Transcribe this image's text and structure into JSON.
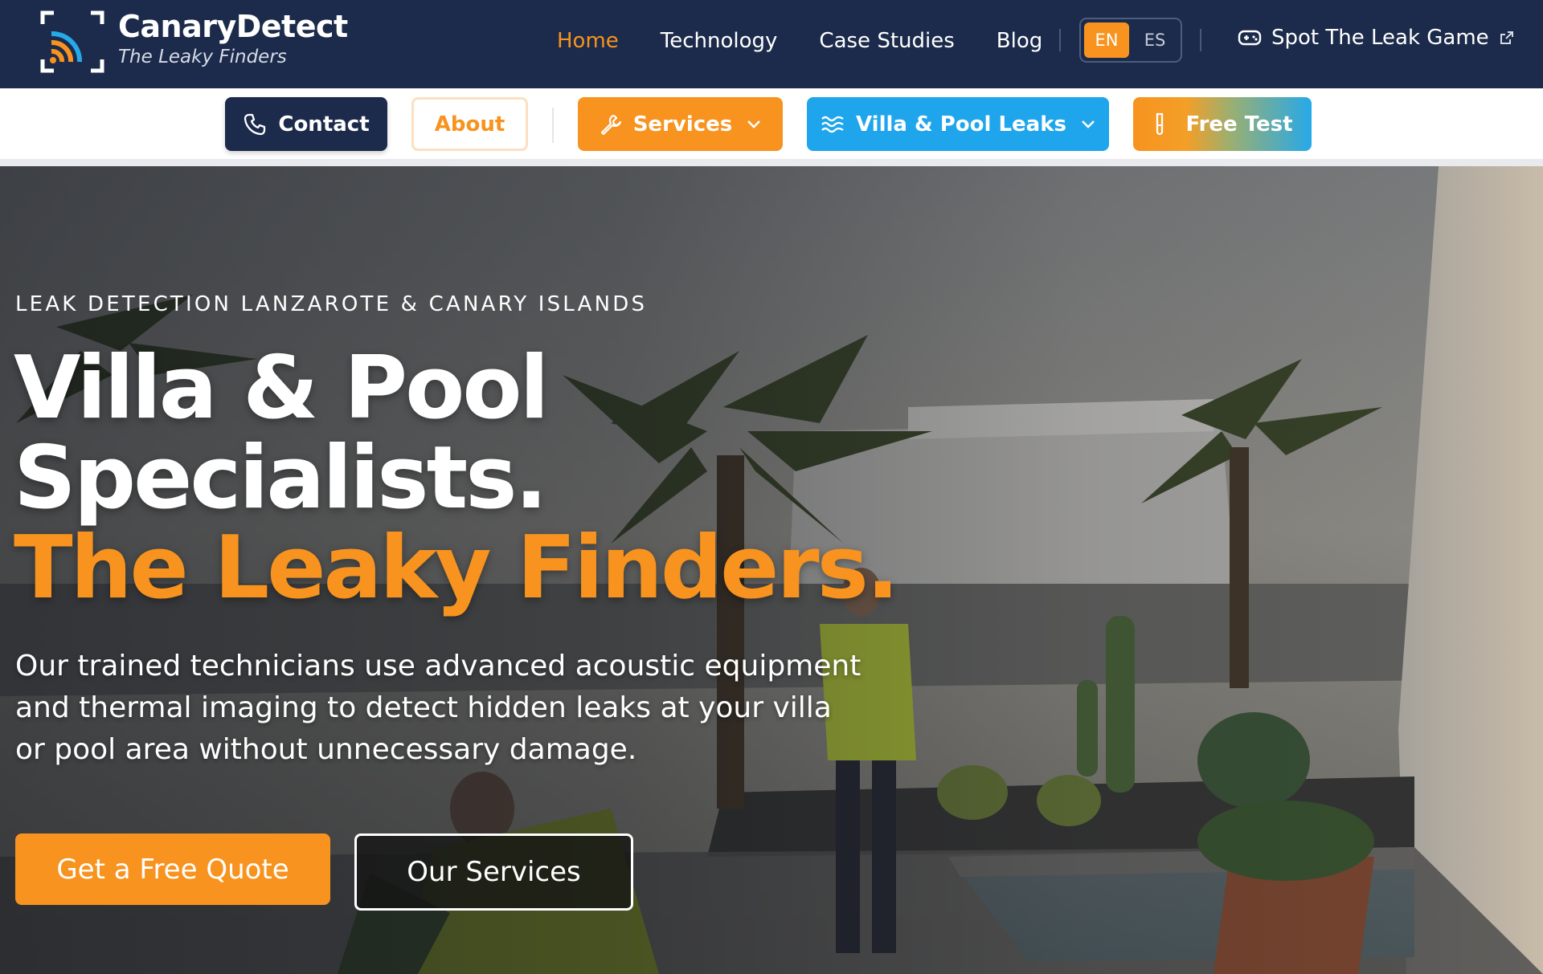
{
  "brand": {
    "name": "CanaryDetect",
    "tagline": "The Leaky Finders"
  },
  "nav": {
    "links": [
      {
        "label": "Home",
        "active": true
      },
      {
        "label": "Technology",
        "active": false
      },
      {
        "label": "Case Studies",
        "active": false
      },
      {
        "label": "Blog",
        "active": false
      }
    ],
    "languages": [
      {
        "code": "EN",
        "selected": true
      },
      {
        "code": "ES",
        "selected": false
      }
    ],
    "game_link": {
      "label": "Spot The Leak Game",
      "icon": "gamepad-icon",
      "trailing_icon": "external-link-icon"
    }
  },
  "subnav": {
    "contact": {
      "label": "Contact",
      "icon": "phone-icon"
    },
    "about": {
      "label": "About"
    },
    "services": {
      "label": "Services",
      "icon": "wrench-icon",
      "dropdown": true
    },
    "villa": {
      "label": "Villa & Pool Leaks",
      "icon": "waves-icon",
      "dropdown": true
    },
    "free_test": {
      "label": "Free Test",
      "icon": "test-tube-icon"
    }
  },
  "hero": {
    "eyebrow": "LEAK DETECTION LANZAROTE & CANARY ISLANDS",
    "headline_line1": "Villa & Pool",
    "headline_line2": "Specialists.",
    "headline_line3": "The Leaky Finders.",
    "lead": "Our trained technicians use advanced acoustic equipment and thermal imaging to detect hidden leaks at your villa or pool area without unnecessary damage.",
    "primary_cta": "Get a Free Quote",
    "secondary_cta": "Our Services"
  },
  "colors": {
    "navy": "#1c2b4b",
    "orange": "#f7931e",
    "blue": "#1ea5ec",
    "white": "#ffffff"
  }
}
